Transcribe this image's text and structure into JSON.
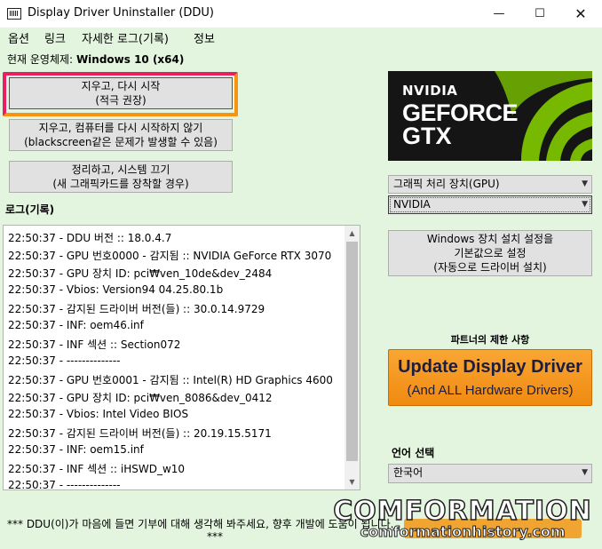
{
  "window": {
    "title": "Display Driver Uninstaller (DDU)",
    "minimize": "—",
    "maximize": "☐",
    "close": "✕"
  },
  "menu": [
    "옵션",
    "링크",
    "자세한 로그(기록)",
    "정보"
  ],
  "os": {
    "label": "현재 운영체제:",
    "value": "Windows 10 (x64)"
  },
  "actions": {
    "clean_restart": [
      "지우고, 다시 시작",
      "(적극 권장)"
    ],
    "clean_no_restart": [
      "지우고, 컴퓨터를 다시 시작하지 않기",
      "(blackscreen같은 문제가 발생할 수 있음)"
    ],
    "clean_shutdown": [
      "정리하고, 시스템 끄기",
      "(새 그래픽카드를 장착할 경우)"
    ]
  },
  "log": {
    "label": "로그(기록)",
    "lines": [
      "22:50:37 - DDU 버전 :: 18.0.4.7",
      "22:50:37 - GPU 번호0000 - 감지됨 :: NVIDIA GeForce RTX 3070",
      "22:50:37 - GPU 장치 ID: pci₩ven_10de&dev_2484",
      "22:50:37 - Vbios: Version94 04.25.80.1b",
      "22:50:37 - 감지된 드라이버 버전(들) :: 30.0.14.9729",
      "22:50:37 - INF: oem46.inf",
      "22:50:37 - INF 섹션 :: Section072",
      "22:50:37 - --------------",
      "22:50:37 - GPU 번호0001 - 감지됨 :: Intel(R) HD Graphics 4600",
      "22:50:37 - GPU 장치 ID: pci₩ven_8086&dev_0412",
      "22:50:37 - Vbios: Intel Video BIOS",
      "22:50:37 - 감지된 드라이버 버전(들) :: 20.19.15.5171",
      "22:50:37 - INF: oem15.inf",
      "22:50:37 - INF 섹션 :: iHSWD_w10",
      "22:50:37 - --------------"
    ]
  },
  "gpu_logo": {
    "brand": "NVIDIA",
    "line1": "GEFORCE",
    "line2": "GTX"
  },
  "device_type": {
    "selected": "그래픽 처리 장치(GPU)"
  },
  "vendor": {
    "selected": "NVIDIA"
  },
  "device_install_button": [
    "Windows 장치 설치 설정을",
    "기본값으로 설정",
    "(자동으로 드라이버 설치)"
  ],
  "partner": {
    "label": "파트너의 제한 사항",
    "title": "Update Display Driver",
    "subtitle": "(And ALL Hardware Drivers)"
  },
  "language": {
    "label": "언어 선택",
    "selected": "한국어"
  },
  "footer": {
    "line1": "*** DDU(이)가 마음에 들면 기부에 대해 생각해 봐주세요, 향후 개발에 도움이 됩니다.",
    "line2": "***"
  },
  "watermark": {
    "line1": "COMFORMATION",
    "line2": "comformationhistory.com"
  },
  "colors": {
    "background": "#e3f5df",
    "highlight_pink": "#e91e63",
    "highlight_orange": "#f7930e",
    "promo_orange": "#f29516",
    "nvidia_green": "#76b900"
  }
}
